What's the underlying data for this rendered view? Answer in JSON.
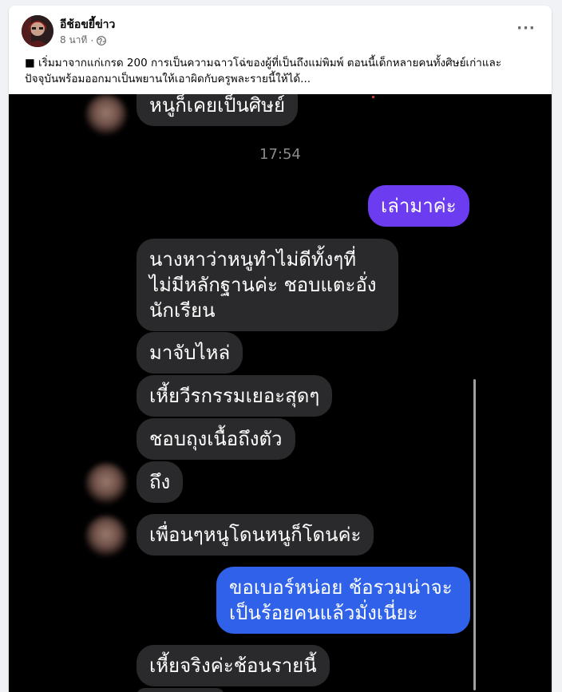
{
  "post": {
    "page_name": "อีช้อขยี้ข่าว",
    "time": "8 นาที",
    "separator": "·",
    "more": "···",
    "caption_line1": "■ เริ่มมาจากแก่เกรด 200 การเป็นความฉาวโฉ่ของผู้ที่เป็นถึงแม่พิมพ์ ตอนนี้เด็กหลายคนทั้งศิษย์เก่าและ",
    "caption_line2": "ปัจจุบันพร้อมออกมาเป็นพยานให้เอาผิดกับครูพละรายนี้ให้ได้..."
  },
  "chat": {
    "time_label": "17:54",
    "messages": [
      {
        "side": "in",
        "text": "หนูก็เคยเป็นศิษย์"
      },
      {
        "side": "out",
        "text": "เล่ามาค่ะ"
      },
      {
        "side": "in",
        "lines": [
          "นางหาว่าหนูทำไม่ดีทั้งๆที่",
          "ไม่มีหลักฐานค่ะ ชอบแตะอั่ง",
          "นักเรียน"
        ]
      },
      {
        "side": "in",
        "text": "มาจับไหล่"
      },
      {
        "side": "in",
        "text": "เหี้ยวีรกรรมเยอะสุดๆ"
      },
      {
        "side": "in",
        "text": "ชอบถุงเนื้อถึงตัว"
      },
      {
        "side": "in",
        "text": "ถึง"
      },
      {
        "side": "in",
        "text": "เพื่อนๆหนูโดนหนูก็โดนค่ะ"
      },
      {
        "side": "out",
        "lines": [
          "ขอเบอร์หน่อย ช้อรวมน่าจะ",
          "เป็นร้อยคนแล้วมั่งเนี่ยะ"
        ]
      },
      {
        "side": "in",
        "text": "เหี้ยจริงค่ะช้อนรายนี้"
      }
    ]
  }
}
